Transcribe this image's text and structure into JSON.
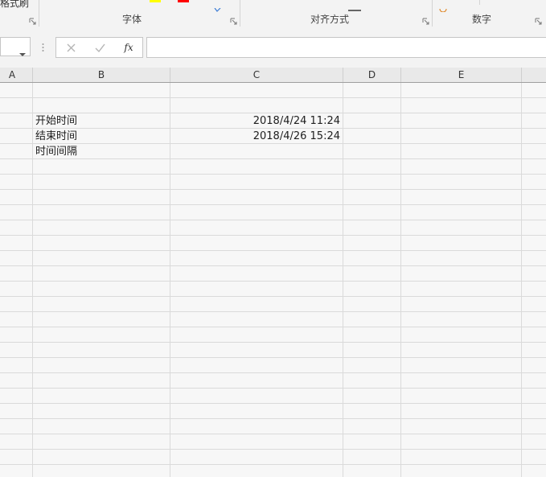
{
  "ribbon": {
    "clipboard_partial_label": "格式刷",
    "font_group_label": "字体",
    "alignment_group_label": "对齐方式",
    "number_group_label": "数字",
    "highlight_color": "#ffff00",
    "font_color": "#ff0000"
  },
  "formula_bar": {
    "name_box_value": "",
    "fx_label": "fx",
    "formula_value": ""
  },
  "columns": [
    "A",
    "B",
    "C",
    "D",
    "E"
  ],
  "cells": {
    "B3": "开始时间",
    "C3": "2018/4/24 11:24",
    "B4": "结束时间",
    "C4": "2018/4/26 15:24",
    "B5": "时间间隔"
  }
}
